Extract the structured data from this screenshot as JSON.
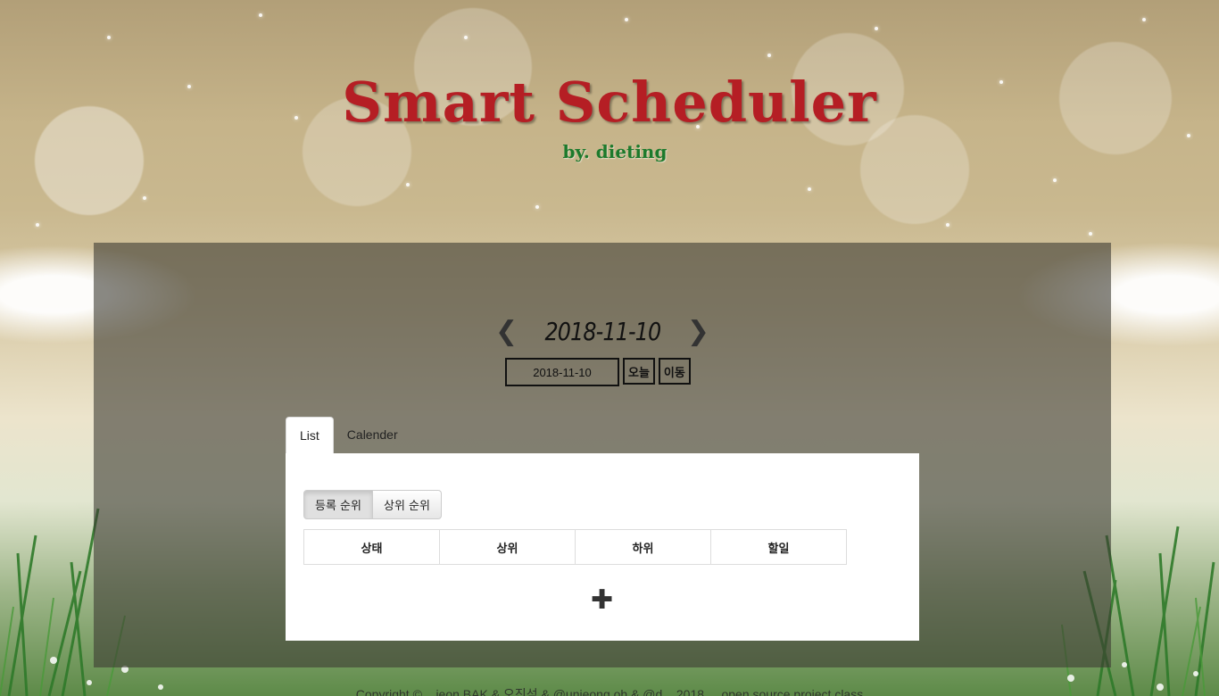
{
  "header": {
    "title": "Smart Scheduler",
    "subtitle": "by. dieting"
  },
  "date_nav": {
    "prev_icon": "chevron-left-icon",
    "current_date": "2018-11-10",
    "next_icon": "chevron-right-icon",
    "date_input_value": "2018-11-10",
    "today_label": "오늘",
    "go_label": "이동"
  },
  "tabs": [
    {
      "label": "List",
      "active": true
    },
    {
      "label": "Calender",
      "active": false
    }
  ],
  "sort_buttons": [
    {
      "label": "등록 순위",
      "active": true
    },
    {
      "label": "상위 순위",
      "active": false
    }
  ],
  "table": {
    "headers": [
      "상태",
      "상위",
      "하위",
      "할일"
    ]
  },
  "add_icon": "plus-icon",
  "footer": {
    "text": "Copyright © ...jeon BAK & 오진석 & @unjeong.oh & @d... 2018 ... open source project class"
  },
  "colors": {
    "title": "#b51e24",
    "subtitle": "#1d7a2c"
  }
}
